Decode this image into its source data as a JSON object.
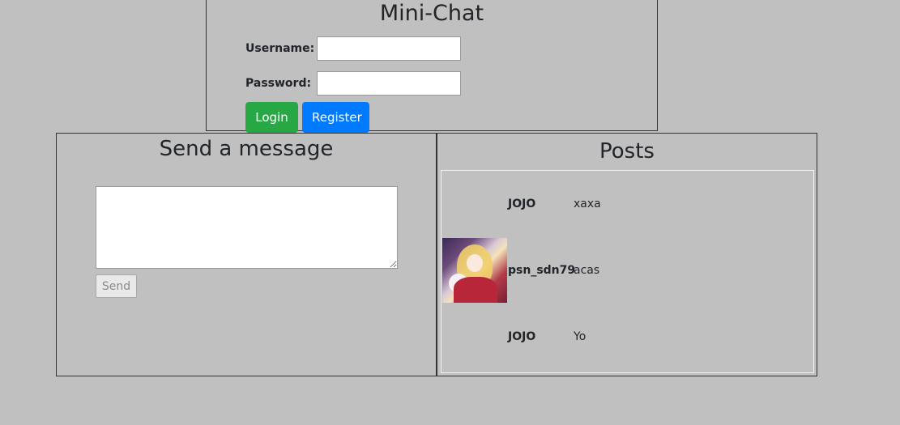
{
  "login": {
    "title": "Mini-Chat",
    "username_label": "Username:",
    "username_value": "",
    "password_label": "Password:",
    "password_value": "",
    "login_button": "Login",
    "register_button": "Register",
    "colors": {
      "login": "#28a745",
      "register": "#007bff"
    }
  },
  "send": {
    "title": "Send a message",
    "message_value": "",
    "send_button": "Send"
  },
  "posts": {
    "title": "Posts",
    "items": [
      {
        "user": "JOJO",
        "text": "xaxa",
        "has_avatar": false
      },
      {
        "user": "psn_sdn79",
        "text": "acas",
        "has_avatar": true,
        "avatar_icon": "anime-girl-avatar"
      },
      {
        "user": "JOJO",
        "text": "Yo",
        "has_avatar": false
      }
    ]
  }
}
